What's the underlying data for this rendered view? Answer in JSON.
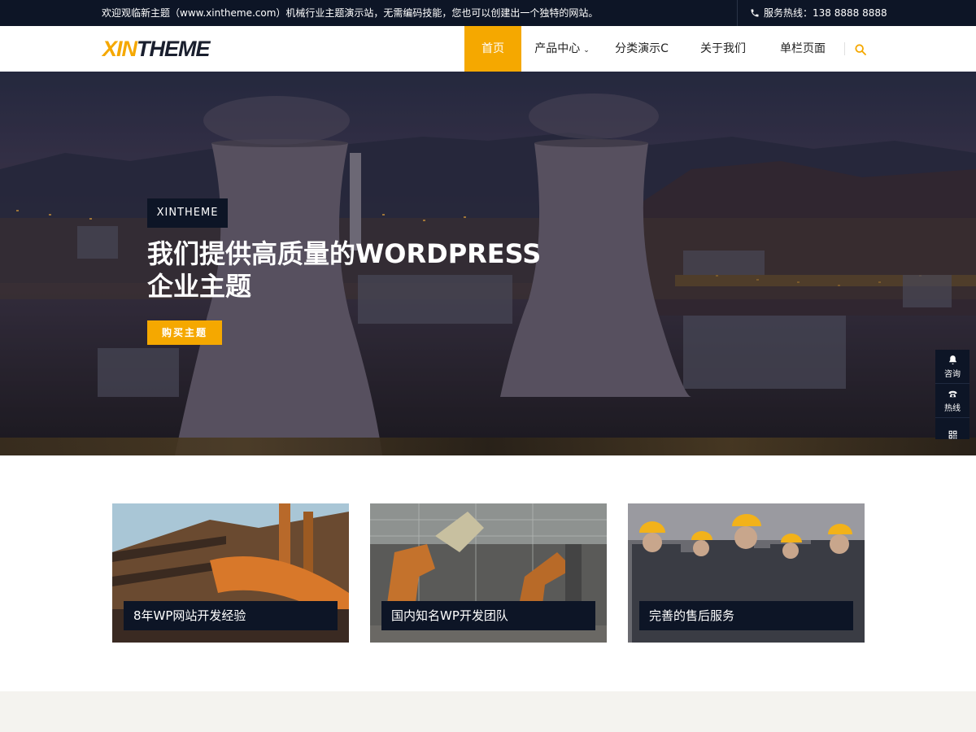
{
  "topbar": {
    "welcome": "欢迎观临新主题（www.xintheme.com）机械行业主题演示站，无需编码技能，您也可以创建出一个独特的网站。",
    "hotline": "服务热线：138 8888 8888"
  },
  "header": {
    "logo_part1": "XIN",
    "logo_part2": "THEME",
    "nav": [
      {
        "label": "首页",
        "active": true
      },
      {
        "label": "产品中心",
        "has_dropdown": true
      },
      {
        "label": "分类演示C"
      },
      {
        "label": "关于我们"
      },
      {
        "label": "单栏页面"
      }
    ],
    "search_icon": "search-icon"
  },
  "hero": {
    "tag": "XINTHEME",
    "title_line1": "我们提供高质量的WORDPRESS",
    "title_line2": "企业主题",
    "button": "购买主题"
  },
  "sidebar": {
    "items": [
      {
        "label": "咨询",
        "icon": "bell-icon"
      },
      {
        "label": "热线",
        "icon": "phone-icon"
      },
      {
        "label": "",
        "icon": "qrcode-icon"
      }
    ]
  },
  "features": {
    "cards": [
      {
        "caption": "8年WP网站开发经验"
      },
      {
        "caption": "国内知名WP开发团队"
      },
      {
        "caption": "完善的售后服务"
      }
    ]
  },
  "colors": {
    "accent": "#f5a800",
    "dark": "#0d1526"
  }
}
